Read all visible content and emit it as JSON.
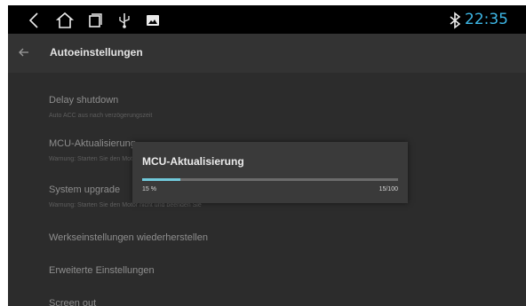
{
  "status_bar": {
    "icons": [
      "back-icon",
      "home-icon",
      "recent-apps-icon",
      "usb-icon",
      "gallery-icon",
      "bluetooth-icon"
    ],
    "clock": "22:35",
    "clock_color": "#3db7e6"
  },
  "app_bar": {
    "back_icon": "arrow-left-icon",
    "title": "Autoeinstellungen"
  },
  "settings": {
    "delay_shutdown": {
      "title": "Delay shutdown",
      "subtitle": "Auto ACC aus nach verzögerungszeit"
    },
    "mcu_update": {
      "title": "MCU-Aktualisierung",
      "subtitle": "Warnung: Starten Sie den Motor nicht und beenden Sie"
    },
    "system_upgrade": {
      "title": "System upgrade",
      "subtitle": "Warnung: Starten Sie den Motor nicht und beenden Sie"
    },
    "factory_reset": {
      "title": "Werkseinstellungen wiederherstellen"
    },
    "advanced": {
      "title": "Erweiterte Einstellungen"
    },
    "screen_out": {
      "title": "Screen out"
    }
  },
  "dialog": {
    "title": "MCU-Aktualisierung",
    "percent_label": "15 %",
    "count_label": "15/100",
    "progress": 0.15,
    "accent_color": "#71c9da"
  }
}
